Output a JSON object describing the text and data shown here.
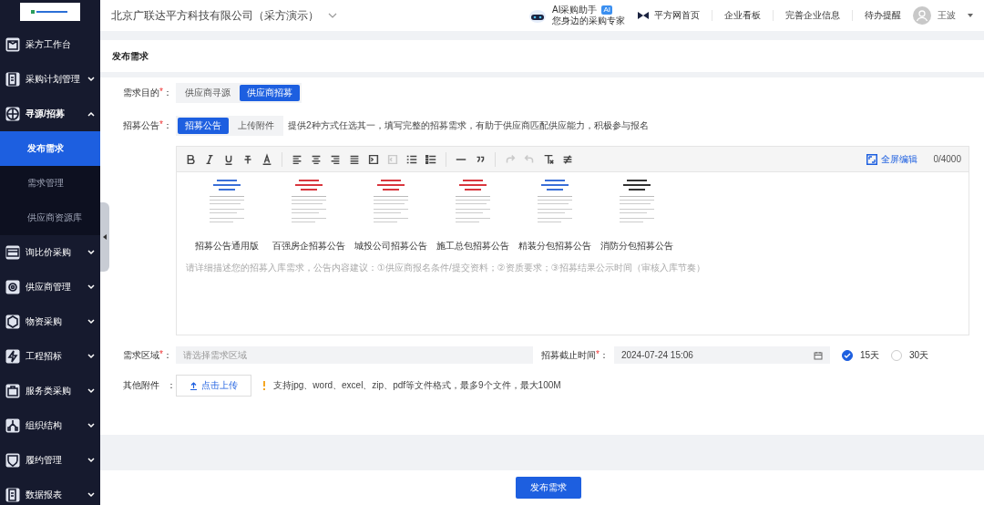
{
  "header": {
    "company": "北京广联达平方科技有限公司（采方演示）",
    "assistant": {
      "title": "AI采购助手",
      "badge": "AI",
      "subtitle": "您身边的采购专家"
    },
    "links": [
      {
        "label": "平方网首页",
        "kind": "brand"
      },
      {
        "label": "企业看板",
        "kind": "plain"
      },
      {
        "label": "完善企业信息",
        "kind": "plain"
      },
      {
        "label": "待办提醒",
        "kind": "plain"
      }
    ],
    "user": "王波"
  },
  "sidebar": {
    "items": [
      {
        "label": "采方工作台",
        "kind": "box",
        "expandable": false
      },
      {
        "label": "采购计划管理",
        "kind": "plan",
        "expandable": true,
        "expanded": false
      },
      {
        "label": "寻源/招募",
        "kind": "globe",
        "expandable": true,
        "expanded": true,
        "children": [
          {
            "label": "发布需求",
            "selected": true
          },
          {
            "label": "需求管理",
            "selected": false
          },
          {
            "label": "供应商资源库",
            "selected": false
          }
        ]
      },
      {
        "label": "询比价采购",
        "kind": "card",
        "expandable": true,
        "expanded": false
      },
      {
        "label": "供应商管理",
        "kind": "gear",
        "expandable": true,
        "expanded": false
      },
      {
        "label": "物资采购",
        "kind": "cube",
        "expandable": true,
        "expanded": false
      },
      {
        "label": "工程招标",
        "kind": "bolt",
        "expandable": true,
        "expanded": false
      },
      {
        "label": "服务类采购",
        "kind": "bag",
        "expandable": true,
        "expanded": false
      },
      {
        "label": "组织结构",
        "kind": "org",
        "expandable": true,
        "expanded": false
      },
      {
        "label": "履约管理",
        "kind": "shield",
        "expandable": true,
        "expanded": false
      },
      {
        "label": "数据报表",
        "kind": "plan",
        "expandable": true,
        "expanded": false
      }
    ]
  },
  "page_title": "发布需求",
  "form": {
    "purpose": {
      "label": "需求目的",
      "required_mark": "*",
      "colon": "：",
      "options": [
        {
          "label": "供应商寻源",
          "selected": false
        },
        {
          "label": "供应商招募",
          "selected": true
        }
      ]
    },
    "notice": {
      "label": "招募公告",
      "required_mark": "*",
      "colon": "：",
      "options": [
        {
          "label": "招募公告",
          "selected": true
        },
        {
          "label": "上传附件",
          "selected": false
        }
      ],
      "hint": "提供2种方式任选其一，填写完整的招募需求，有助于供应商匹配供应能力，积极参与报名"
    },
    "editor": {
      "toolbar": [
        [
          {
            "kind": "bold",
            "disabled": false
          },
          {
            "kind": "italic",
            "disabled": false
          },
          {
            "kind": "underline",
            "disabled": false
          },
          {
            "kind": "strike",
            "disabled": false
          },
          {
            "kind": "color",
            "disabled": false
          }
        ],
        [
          {
            "kind": "left",
            "disabled": false
          },
          {
            "kind": "center",
            "disabled": false
          },
          {
            "kind": "right",
            "disabled": false
          },
          {
            "kind": "justify",
            "disabled": false
          },
          {
            "kind": "indent",
            "disabled": false
          },
          {
            "kind": "outdent",
            "disabled": true
          },
          {
            "kind": "olist",
            "disabled": false
          },
          {
            "kind": "ulist",
            "disabled": false
          }
        ],
        [
          {
            "kind": "hr",
            "disabled": false
          },
          {
            "kind": "quote",
            "disabled": false
          }
        ],
        [
          {
            "kind": "redo",
            "disabled": true
          },
          {
            "kind": "undo",
            "disabled": true
          },
          {
            "kind": "clear",
            "disabled": false
          },
          {
            "kind": "format",
            "disabled": false
          }
        ]
      ],
      "fullscreen": "全屏编辑",
      "count": "0/4000",
      "templates": [
        {
          "name": "招募公告通用版",
          "color": "#3a6fd8"
        },
        {
          "name": "百强房企招募公告",
          "color": "#d9363e"
        },
        {
          "name": "城投公司招募公告",
          "color": "#d9363e"
        },
        {
          "name": "施工总包招募公告",
          "color": "#d9363e"
        },
        {
          "name": "精装分包招募公告",
          "color": "#3a6fd8"
        },
        {
          "name": "消防分包招募公告",
          "color": "#333333"
        }
      ],
      "placeholder": "请详细描述您的招募入库需求，公告内容建议：①供应商报名条件/提交资料；②资质要求；③招募结果公示时间（审核入库节奏）"
    },
    "region": {
      "label": "需求区域",
      "required_mark": "*",
      "colon": "：",
      "placeholder": "请选择需求区域"
    },
    "deadline": {
      "label": "招募截止时间",
      "required_mark": "*",
      "colon": "：",
      "value": "2024-07-24 15:06",
      "options": [
        {
          "label": "15天",
          "selected": true
        },
        {
          "label": "30天",
          "selected": false
        }
      ]
    },
    "attachment": {
      "label": "其他附件",
      "colon": "：",
      "button": "点击上传",
      "hint": "支持jpg、word、excel、zip、pdf等文件格式，最多9个文件，最大100M"
    }
  },
  "submit": "发布需求"
}
